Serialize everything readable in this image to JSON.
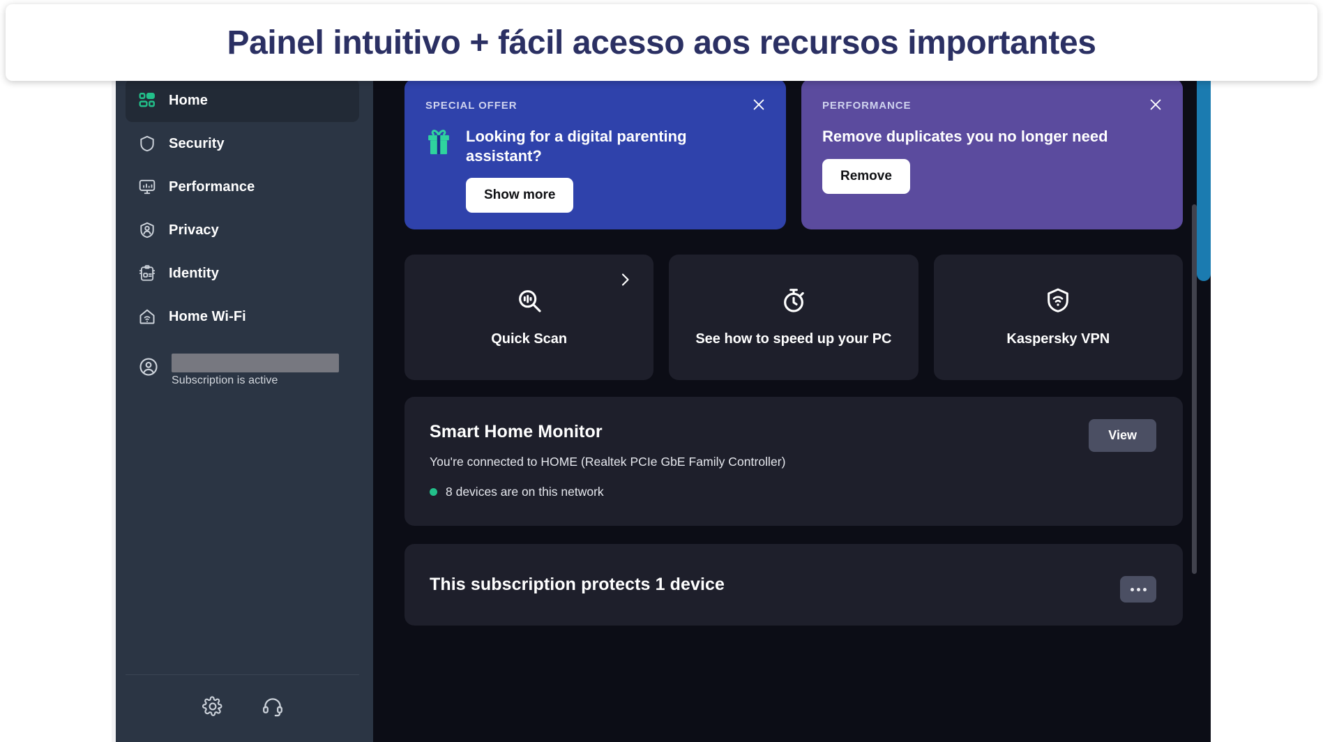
{
  "banner": {
    "title": "Painel intuitivo + fácil acesso aos recursos importantes"
  },
  "sidebar": {
    "items": [
      {
        "label": "Home",
        "icon": "grid-icon",
        "active": true
      },
      {
        "label": "Security",
        "icon": "shield-icon",
        "active": false
      },
      {
        "label": "Performance",
        "icon": "monitor-icon",
        "active": false
      },
      {
        "label": "Privacy",
        "icon": "privacy-shield-icon",
        "active": false
      },
      {
        "label": "Identity",
        "icon": "id-card-icon",
        "active": false
      },
      {
        "label": "Home Wi-Fi",
        "icon": "home-wifi-icon",
        "active": false
      }
    ],
    "account": {
      "name_redacted": "",
      "status": "Subscription is active"
    },
    "footer": {
      "settings_icon": "gear-icon",
      "support_icon": "headset-icon"
    }
  },
  "main": {
    "promos": [
      {
        "kicker": "SPECIAL OFFER",
        "title": "Looking for a digital parenting assistant?",
        "button": "Show more",
        "icon": "gift-icon",
        "close_icon": "close-icon",
        "color": "#2f42ab"
      },
      {
        "kicker": "PERFORMANCE",
        "title": "Remove duplicates you no longer need",
        "button": "Remove",
        "icon": "",
        "close_icon": "close-icon",
        "color": "#5b4b9e"
      }
    ],
    "tiles": [
      {
        "label": "Quick Scan",
        "icon": "scan-magnifier-icon",
        "chevron": true
      },
      {
        "label": "See how to speed up your PC",
        "icon": "stopwatch-icon",
        "chevron": false
      },
      {
        "label": "Kaspersky VPN",
        "icon": "vpn-shield-wifi-icon",
        "chevron": false
      }
    ],
    "smart_home": {
      "title": "Smart Home Monitor",
      "subtitle": "You're connected to HOME (Realtek PCIe GbE Family Controller)",
      "status": "8 devices are on this network",
      "button": "View",
      "status_color": "#22c08a"
    },
    "subscription": {
      "title": "This subscription protects 1 device",
      "more_icon": "ellipsis-icon"
    }
  },
  "colors": {
    "sidebar_bg": "#2b3544",
    "main_bg": "#0c0d16",
    "card_bg": "#1e1f2b",
    "accent_green": "#22c08a",
    "accent_blue": "#1b7bb0",
    "banner_text": "#2b3063"
  }
}
